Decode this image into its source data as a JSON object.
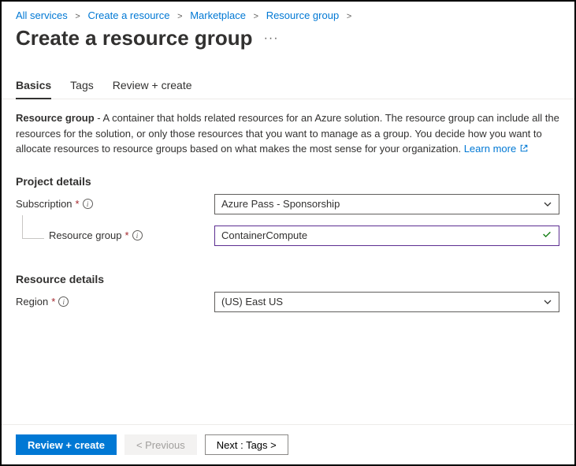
{
  "breadcrumb": {
    "items": [
      {
        "label": "All services"
      },
      {
        "label": "Create a resource"
      },
      {
        "label": "Marketplace"
      },
      {
        "label": "Resource group"
      }
    ]
  },
  "page": {
    "title": "Create a resource group"
  },
  "tabs": {
    "basics": "Basics",
    "tags": "Tags",
    "review": "Review + create"
  },
  "description": {
    "bold": "Resource group",
    "text": " - A container that holds related resources for an Azure solution. The resource group can include all the resources for the solution, or only those resources that you want to manage as a group. You decide how you want to allocate resources to resource groups based on what makes the most sense for your organization. ",
    "learn_more": "Learn more"
  },
  "sections": {
    "project": {
      "title": "Project details",
      "subscription_label": "Subscription",
      "subscription_value": "Azure Pass - Sponsorship",
      "rg_label": "Resource group",
      "rg_value": "ContainerCompute"
    },
    "resource": {
      "title": "Resource details",
      "region_label": "Region",
      "region_value": "(US) East US"
    }
  },
  "footer": {
    "review": "Review + create",
    "prev": "< Previous",
    "next": "Next : Tags >"
  }
}
